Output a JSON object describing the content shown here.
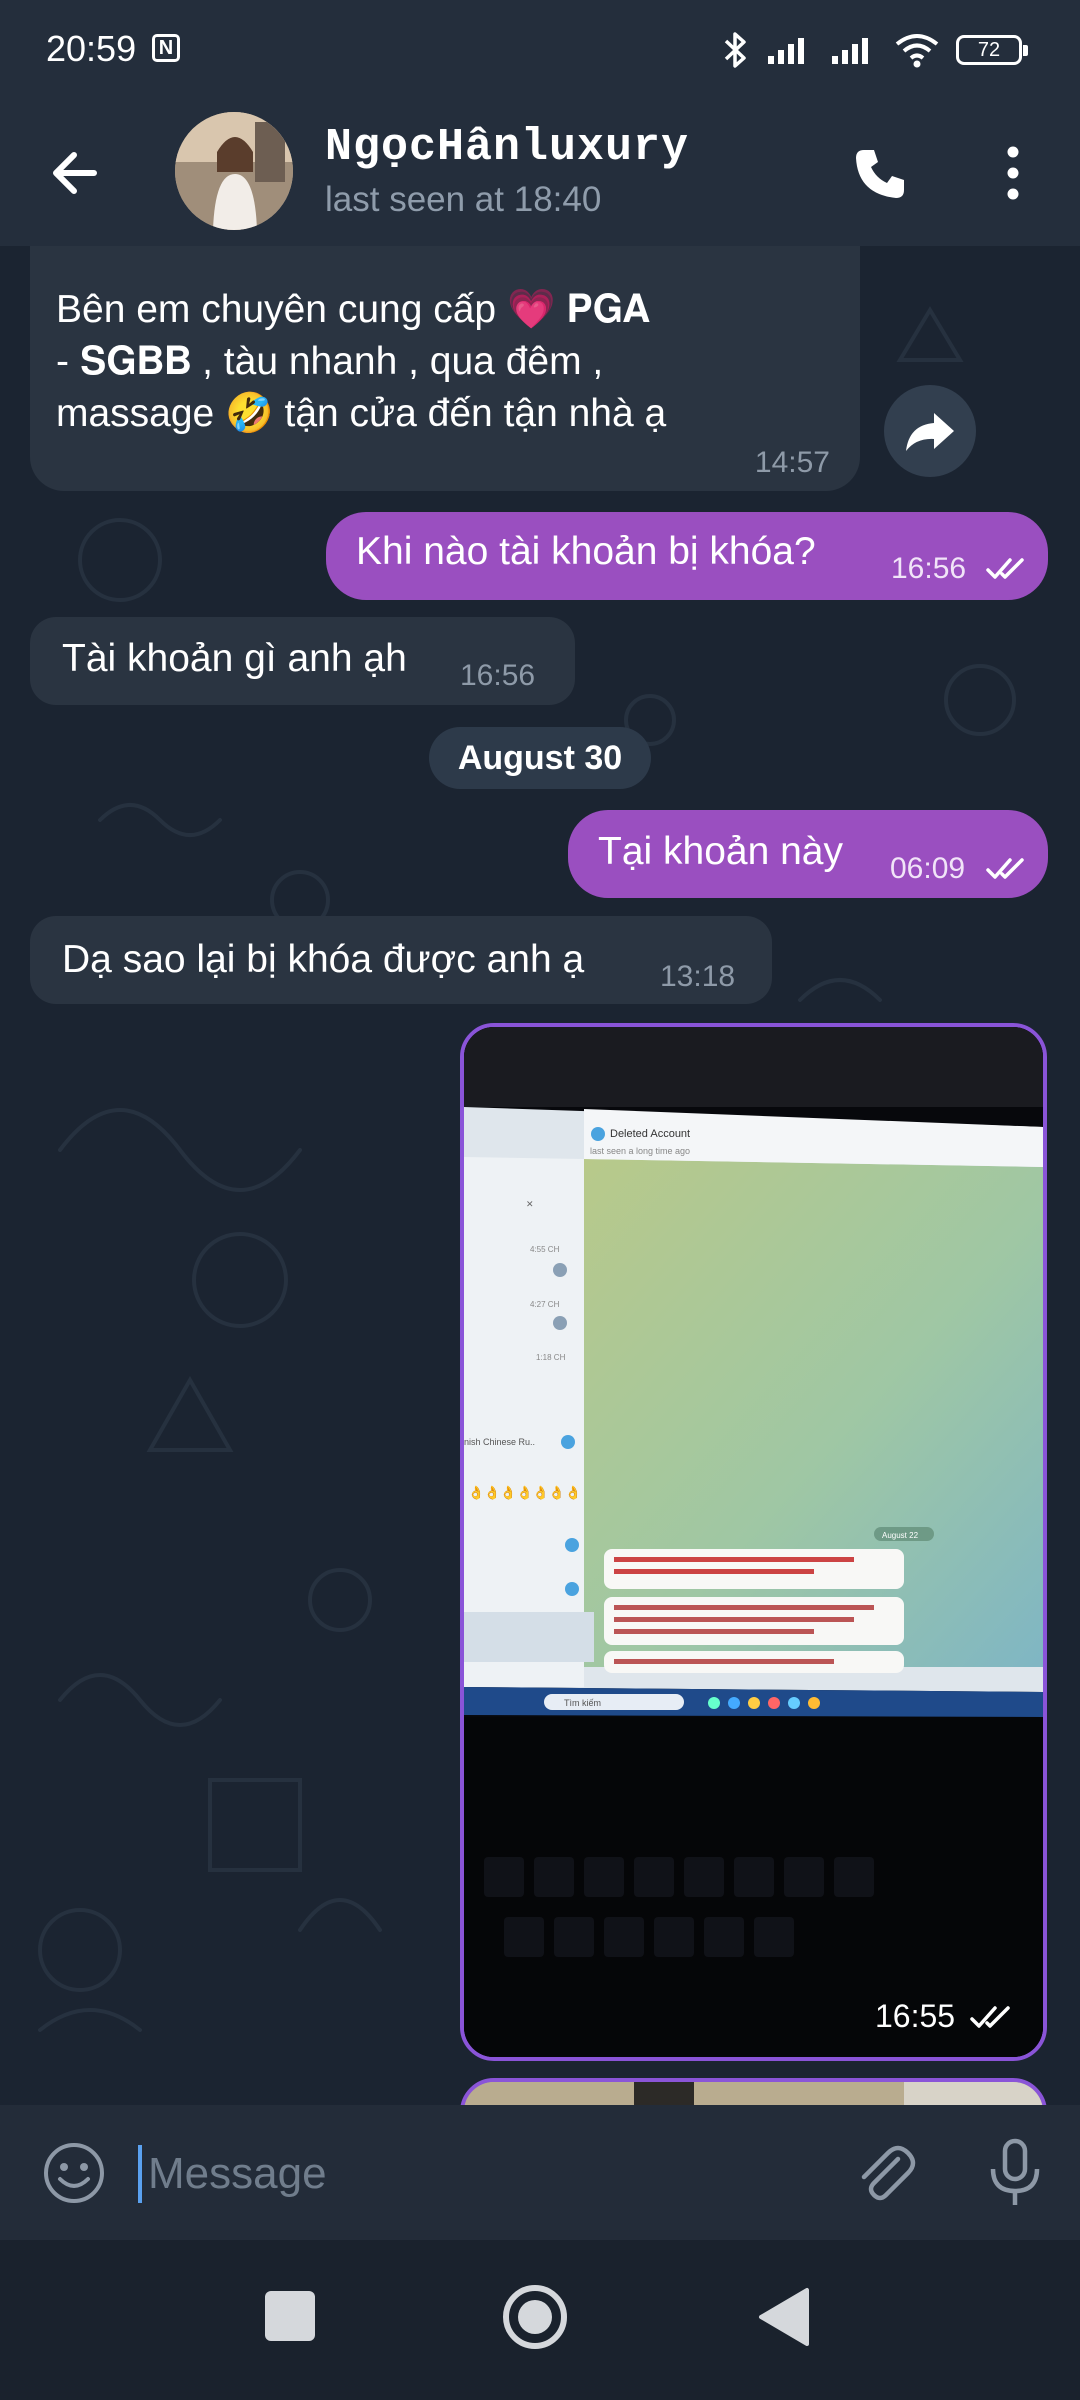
{
  "status_bar": {
    "time": "20:59",
    "nfc_icon": "nfc-icon",
    "battery": "72"
  },
  "header": {
    "name": "NgọcHânluxury",
    "last_seen": "last seen at 18:40"
  },
  "messages": [
    {
      "direction": "in",
      "text_line1": "Bên em chuyên cung cấp 💗 𝐏𝐆𝐀",
      "text_line2": "- 𝐒𝐆𝐁𝐁 , tàu nhanh , qua đêm ,",
      "text_line3": "massage 🤣 tận cửa đến tận nhà ạ",
      "time": "14:57"
    },
    {
      "direction": "out",
      "text": "Khi nào tài khoản bị khóa?",
      "time": "16:56"
    },
    {
      "direction": "in",
      "text": "Tài khoản gì anh ạh",
      "time": "16:56"
    },
    {
      "direction": "out",
      "text": "Tại khoản này",
      "time": "06:09"
    },
    {
      "direction": "in",
      "text": "Dạ sao lại bị khóa được anh ạ",
      "time": "13:18"
    },
    {
      "direction": "out",
      "type": "photo",
      "time": "16:55"
    }
  ],
  "date_separator": "August 30",
  "photo": {
    "deleted_title": "Deleted Account",
    "deleted_sub": "last seen a long time ago",
    "date_chip": "August 22",
    "taskbar_search": "Tìm kiếm"
  },
  "input": {
    "placeholder": "Message"
  },
  "colors": {
    "outgoing_bubble": "#9a4fc0",
    "incoming_bubble": "#2a3441",
    "header_bg": "#242e3c",
    "chat_bg": "#1b2431"
  }
}
